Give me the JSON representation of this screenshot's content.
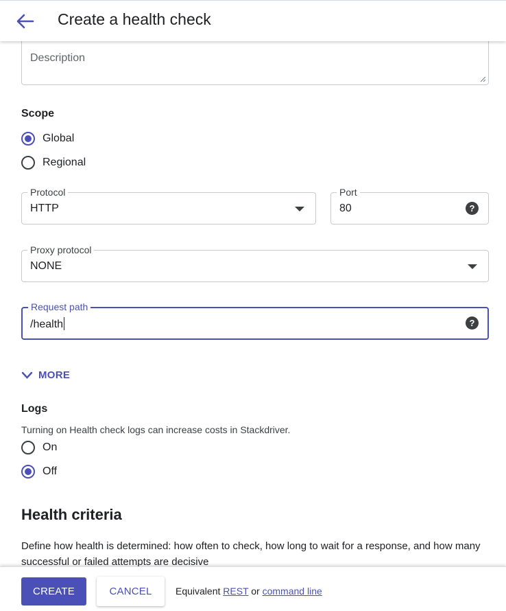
{
  "header": {
    "back_icon": "arrow-back-icon",
    "title": "Create a health check"
  },
  "form": {
    "description": {
      "placeholder": "Description",
      "value": ""
    },
    "scope": {
      "label": "Scope",
      "options": [
        {
          "label": "Global",
          "checked": true
        },
        {
          "label": "Regional",
          "checked": false
        }
      ]
    },
    "protocol": {
      "label": "Protocol",
      "value": "HTTP",
      "icon": "dropdown-arrow-icon"
    },
    "port": {
      "label": "Port",
      "value": "80",
      "help_icon": "help-icon",
      "help_glyph": "?"
    },
    "proxy_protocol": {
      "label": "Proxy protocol",
      "value": "NONE",
      "icon": "dropdown-arrow-icon"
    },
    "request_path": {
      "label": "Request path",
      "value": "/health",
      "help_icon": "help-icon",
      "help_glyph": "?",
      "focused": true
    },
    "more": {
      "label": "MORE",
      "icon": "chevron-down-icon"
    },
    "logs": {
      "label": "Logs",
      "note": "Turning on Health check logs can increase costs in Stackdriver.",
      "options": [
        {
          "label": "On",
          "checked": false
        },
        {
          "label": "Off",
          "checked": true
        }
      ]
    }
  },
  "health_criteria": {
    "title": "Health criteria",
    "text": "Define how health is determined: how often to check, how long to wait for a response, and how many successful or failed attempts are decisive"
  },
  "footer": {
    "create_label": "CREATE",
    "cancel_label": "CANCEL",
    "equivalent_prefix": "Equivalent",
    "rest_link": "REST",
    "or_text": "or",
    "command_line_link": "command line"
  },
  "colors": {
    "accent": "#4a50b5",
    "text": "#202124",
    "border": "#c8cacd"
  }
}
